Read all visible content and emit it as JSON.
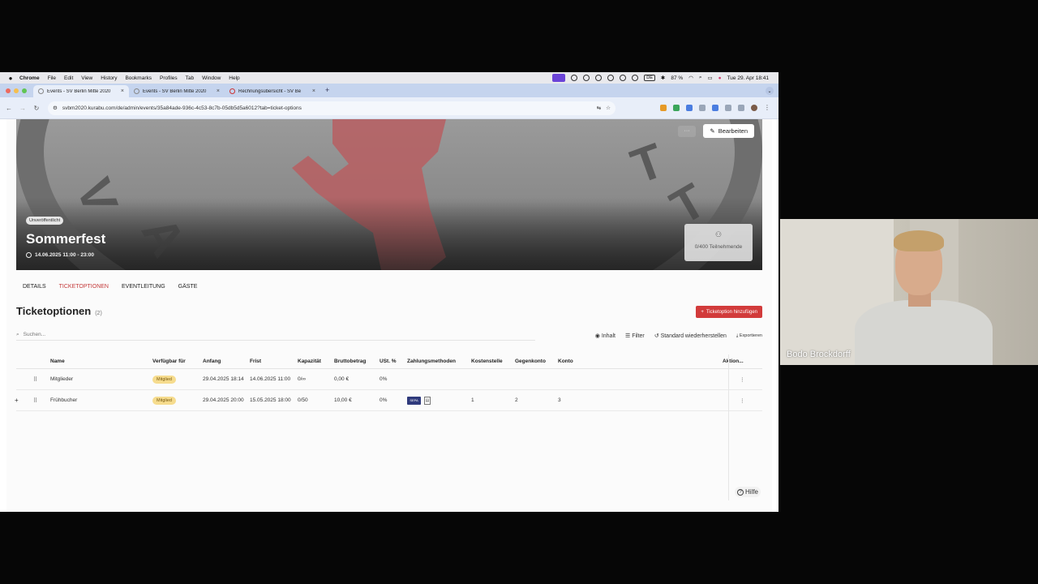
{
  "menubar": {
    "apple": "",
    "items": [
      "Chrome",
      "File",
      "Edit",
      "View",
      "History",
      "Bookmarks",
      "Profiles",
      "Tab",
      "Window",
      "Help"
    ],
    "input_source": "DE",
    "battery": "87 %",
    "datetime": "Tue 29. Apr 18:41"
  },
  "browser": {
    "tabs": [
      {
        "title": "Events - SV Berlin Mitte 2020",
        "active": true
      },
      {
        "title": "Events - SV Berlin Mitte 2020",
        "active": false
      },
      {
        "title": "Rechnungsübersicht - SV Be",
        "active": false
      }
    ],
    "url": "svbm2020.kurabu.com/de/admin/events/35a84ade-936c-4c53-8c7b-05db5d5a6012?tab=ticket-options"
  },
  "event": {
    "edit_label": "Bearbeiten",
    "more_label": "···",
    "status_badge": "Unveröffentlicht",
    "title": "Sommerfest",
    "date": "14.06.2025 11:00 - 23:00",
    "attendees": "0/400 Teilnehmende"
  },
  "tabs": {
    "details": "DETAILS",
    "ticket_options": "TICKETOPTIONEN",
    "event_lead": "EVENTLEITUNG",
    "guests": "GÄSTE"
  },
  "section": {
    "title": "Ticketoptionen",
    "count": "(2)",
    "add_label": "Ticketoption hinzufügen"
  },
  "toolbar": {
    "search_placeholder": "Suchen...",
    "content": "Inhalt",
    "filter": "Filter",
    "reset": "Standard wiederherstellen",
    "export": "Exportieren"
  },
  "table": {
    "columns": [
      "Name",
      "Verfügbar für",
      "Anfang",
      "Frist",
      "Kapazität",
      "Bruttobetrag",
      "USt. %",
      "Zahlungsmethoden",
      "Kostenstelle",
      "Gegenkonto",
      "Konto",
      "Aktion..."
    ],
    "rows": [
      {
        "name": "Mitglieder",
        "available": "Mitglied",
        "start": "29.04.2025 18:14",
        "deadline": "14.06.2025 11:00",
        "capacity": "0/∞",
        "gross": "0,00 €",
        "vat": "0%",
        "payment": [],
        "cost_center": "",
        "counter_account": "",
        "account": ""
      },
      {
        "name": "Frühbucher",
        "available": "Mitglied",
        "start": "29.04.2025 20:00",
        "deadline": "15.05.2025 18:00",
        "capacity": "0/50",
        "gross": "10,00 €",
        "vat": "0%",
        "payment": [
          "SEPA",
          "Rechnung"
        ],
        "cost_center": "1",
        "counter_account": "2",
        "account": "3"
      }
    ]
  },
  "help_label": "Hilfe",
  "webcam": {
    "participant_name": "Bodo Brockdorff"
  },
  "colors": {
    "accent": "#d23b3b",
    "chip_bg": "#f6dc8e",
    "tab_active": "#c43a3a"
  }
}
